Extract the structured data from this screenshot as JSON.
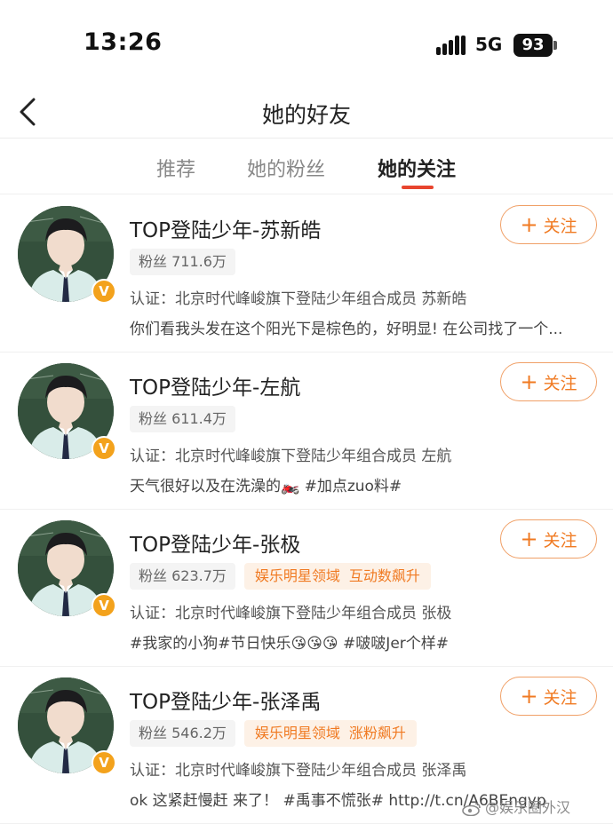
{
  "status_bar": {
    "time": "13:26",
    "network": "5G",
    "battery": "93"
  },
  "header": {
    "title": "她的好友",
    "back_icon": "chevron-left-icon"
  },
  "tabs": [
    {
      "label": "推荐",
      "active": false
    },
    {
      "label": "她的粉丝",
      "active": false
    },
    {
      "label": "她的关注",
      "active": true
    }
  ],
  "colors": {
    "accent": "#e8452e",
    "follow": "#f07a22",
    "verified": "#f3a21c"
  },
  "users": [
    {
      "name": "TOP登陆少年-苏新皓",
      "fans": "粉丝 711.6万",
      "tags": [],
      "cert": "认证：北京时代峰峻旗下登陆少年组合成员 苏新皓",
      "desc": "你们看我头发在这个阳光下是棕色的，好明显! 在公司找了一个...",
      "follow": "关注",
      "verified": "V"
    },
    {
      "name": "TOP登陆少年-左航",
      "fans": "粉丝 611.4万",
      "tags": [],
      "cert": "认证：北京时代峰峻旗下登陆少年组合成员 左航",
      "desc": "天气很好以及在洗澡的🏍️ #加点zuo料#",
      "follow": "关注",
      "verified": "V"
    },
    {
      "name": "TOP登陆少年-张极",
      "fans": "粉丝 623.7万",
      "tags": [
        "娱乐明星领域",
        "互动数飙升"
      ],
      "cert": "认证：北京时代峰峻旗下登陆少年组合成员 张极",
      "desc": "#我家的小狗#节日快乐😘😘😘 #啵啵Jer个样#",
      "follow": "关注",
      "verified": "V"
    },
    {
      "name": "TOP登陆少年-张泽禹",
      "fans": "粉丝 546.2万",
      "tags": [
        "娱乐明星领域",
        "涨粉飙升"
      ],
      "cert": "认证：北京时代峰峻旗下登陆少年组合成员 张泽禹",
      "desc": "ok 这紧赶慢赶 来了！ #禹事不慌张# http://t.cn/A6BEngyp",
      "follow": "关注",
      "verified": "V"
    }
  ],
  "watermark": "@娱乐圈外汉"
}
